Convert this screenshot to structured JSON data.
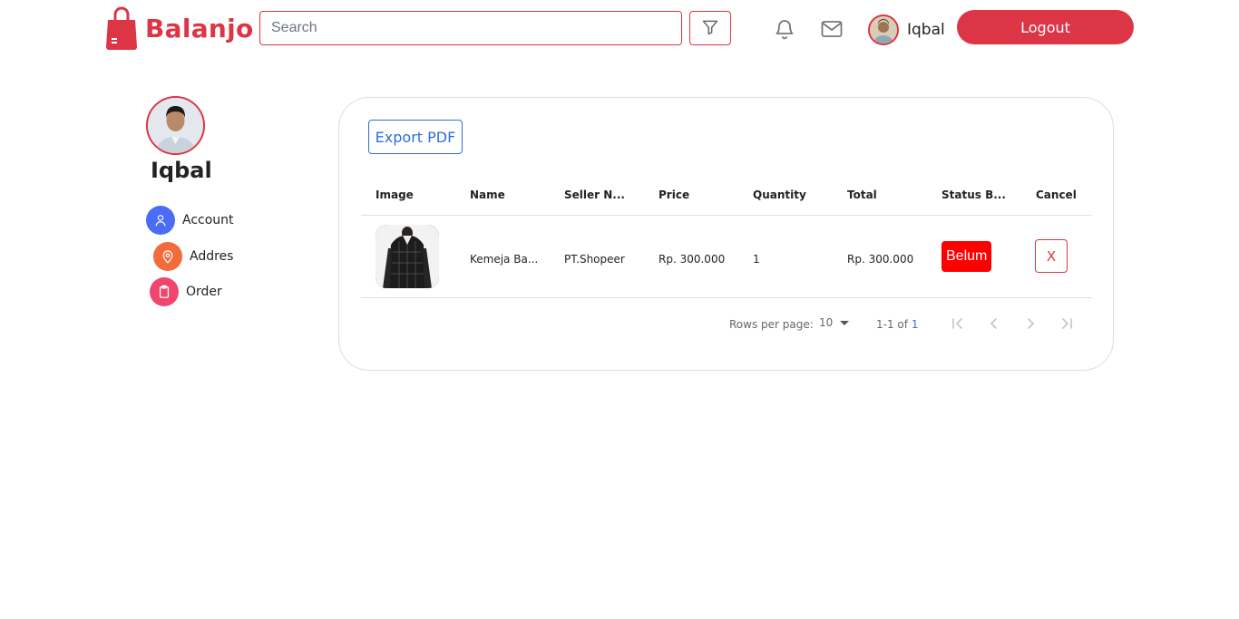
{
  "header": {
    "brand": "Balanjo",
    "search_placeholder": "Search",
    "user_name": "Iqbal",
    "logout_label": "Logout",
    "icons": [
      "shopping-bag-icon",
      "filter-icon",
      "bell-icon",
      "mail-icon"
    ]
  },
  "sidebar": {
    "profile_name": "Iqbal",
    "items": [
      {
        "label": "Account",
        "icon": "user-icon",
        "color": "#4a6cf7"
      },
      {
        "label": "Addres",
        "icon": "map-pin-icon",
        "color": "#f26b3a"
      },
      {
        "label": "Order",
        "icon": "clipboard-icon",
        "color": "#f0466e"
      }
    ]
  },
  "card": {
    "export_label": "Export PDF",
    "columns": [
      "Image",
      "Name",
      "Seller N...",
      "Price",
      "Quantity",
      "Total",
      "Status B...",
      "Cancel"
    ],
    "rows": [
      {
        "name": "Kemeja Ba...",
        "seller": "PT.Shopeer",
        "price": "Rp. 300.000",
        "quantity": "1",
        "total": "Rp. 300.000",
        "status": "Belum",
        "cancel_label": "X"
      }
    ],
    "pagination": {
      "rows_per_page_label": "Rows per page:",
      "rows_per_page": "10",
      "range": "1-1 of",
      "total": "1"
    }
  },
  "colors": {
    "brand": "#dc3545",
    "status_badge": "#ff0000",
    "export_button": "#2f6fdb"
  }
}
